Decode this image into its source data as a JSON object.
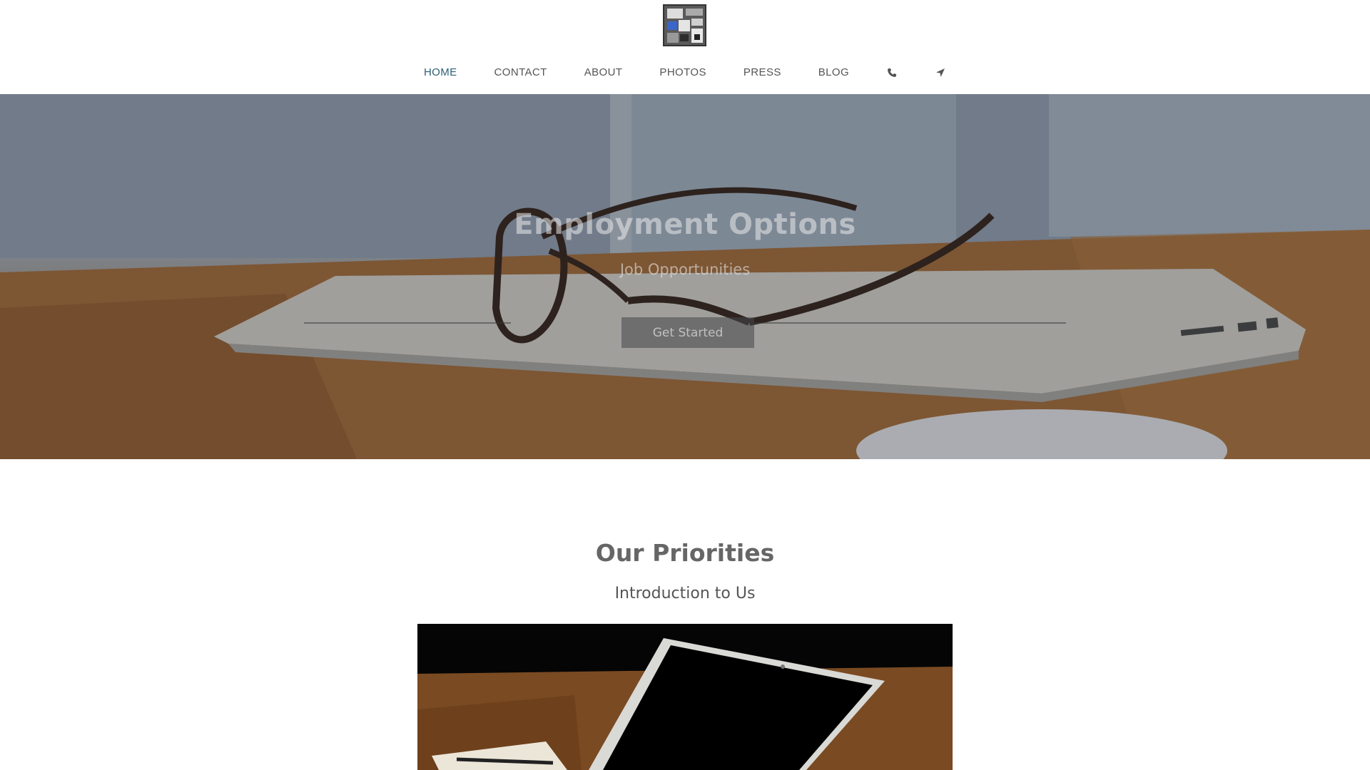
{
  "nav": {
    "items": [
      {
        "label": "HOME",
        "active": true
      },
      {
        "label": "CONTACT",
        "active": false
      },
      {
        "label": "ABOUT",
        "active": false
      },
      {
        "label": "PHOTOS",
        "active": false
      },
      {
        "label": "PRESS",
        "active": false
      },
      {
        "label": "BLOG",
        "active": false
      }
    ],
    "icons": [
      "phone-icon",
      "location-arrow-icon"
    ],
    "active_color": "#2b5f75",
    "text_color": "#555555"
  },
  "hero": {
    "title": "Employment Options",
    "subtitle": "Job Opportunities",
    "button_label": "Get Started"
  },
  "priorities": {
    "title": "Our Priorities",
    "subtitle": "Introduction to Us"
  }
}
